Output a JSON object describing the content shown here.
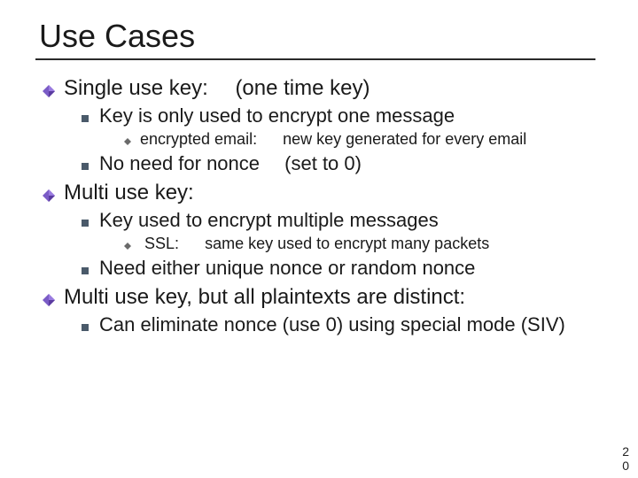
{
  "title": "Use Cases",
  "section1": {
    "heading_a": "Single use key:",
    "heading_b": "(one time key)",
    "line1": "Key is only used to encrypt one message",
    "line1sub_a": "encrypted email:",
    "line1sub_b": "new key generated for every email",
    "line2_a": "No need for nonce",
    "line2_b": "(set to 0)"
  },
  "section2": {
    "heading": "Multi use key:",
    "line1": "Key used to encrypt multiple messages",
    "line1sub_a": "SSL:",
    "line1sub_b": "same key used to encrypt many packets",
    "line2": "Need either unique nonce or random nonce"
  },
  "section3": {
    "heading": "Multi use key, but all plaintexts are distinct:",
    "line1": "Can eliminate nonce (use 0) using special mode (SIV)"
  },
  "page": {
    "a": "2",
    "b": "0"
  }
}
